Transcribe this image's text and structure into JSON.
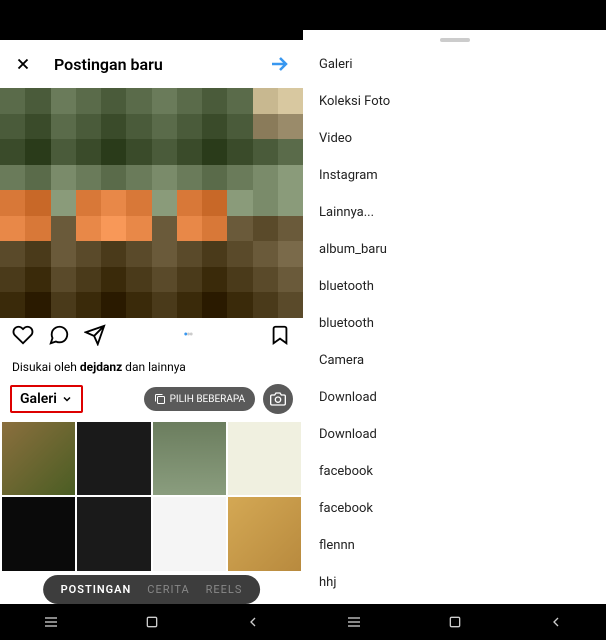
{
  "header": {
    "title": "Postingan baru"
  },
  "post": {
    "likes_prefix": "Disukai oleh ",
    "likes_user": "dejdanz",
    "likes_suffix": " dan lainnya"
  },
  "gallery": {
    "selector_label": "Galeri",
    "pill_label": "PILIH BEBERAPA"
  },
  "tabs": {
    "post": "POSTINGAN",
    "story": "CERITA",
    "reels": "REELS"
  },
  "sheet": {
    "items": [
      "Galeri",
      "Koleksi Foto",
      "Video",
      "Instagram",
      "Lainnya...",
      "album_baru",
      "bluetooth",
      "bluetooth",
      "Camera",
      "Download",
      "Download",
      "facebook",
      "facebook",
      "flennn",
      "hhj"
    ]
  }
}
